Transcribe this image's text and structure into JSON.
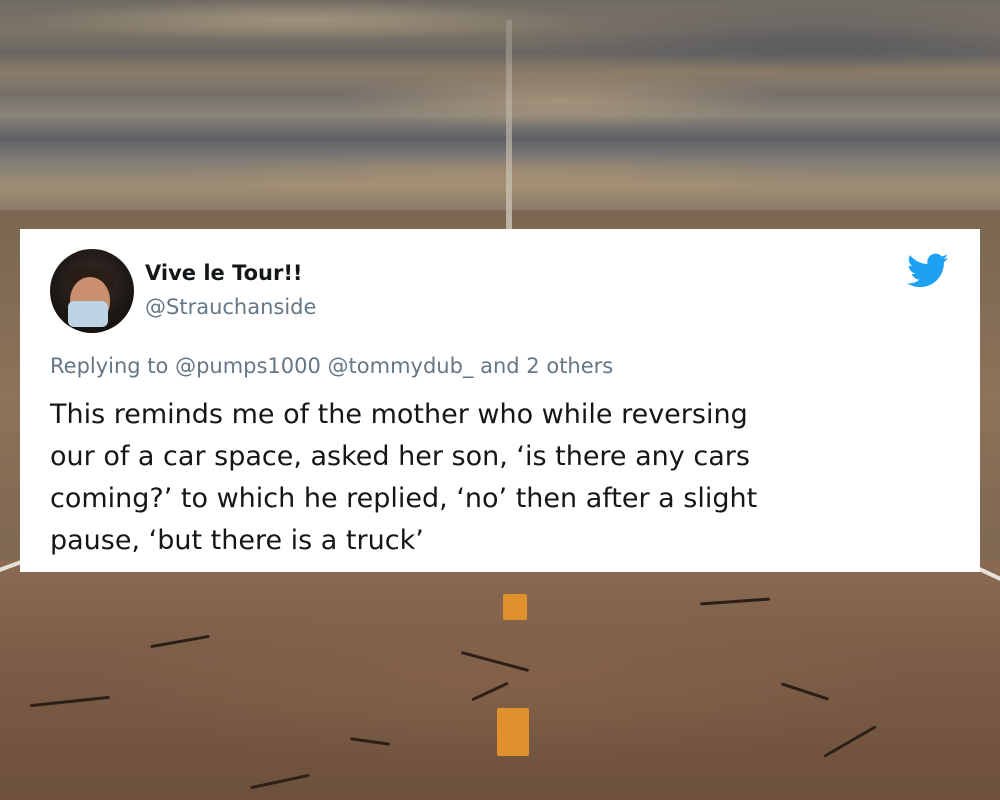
{
  "tweet": {
    "display_name": "Vive le Tour!!",
    "handle": "@Strauchanside",
    "reply_to": "Replying to @pumps1000 @tommydub_ and 2 others",
    "text_lines": [
      "This reminds me of the mother who while reversing",
      "our of a car space, asked her son, ‘is there any cars",
      "coming?’ to which he replied, ‘no’ then after a slight",
      "pause, ‘but there is a truck’"
    ],
    "avatar_icon": "user-avatar-masked",
    "brand_icon": "twitter-bird-icon",
    "brand_color": "#1da1f2"
  },
  "background": {
    "scene": "desert-road-photo",
    "center_line_color": "#e0902c"
  }
}
